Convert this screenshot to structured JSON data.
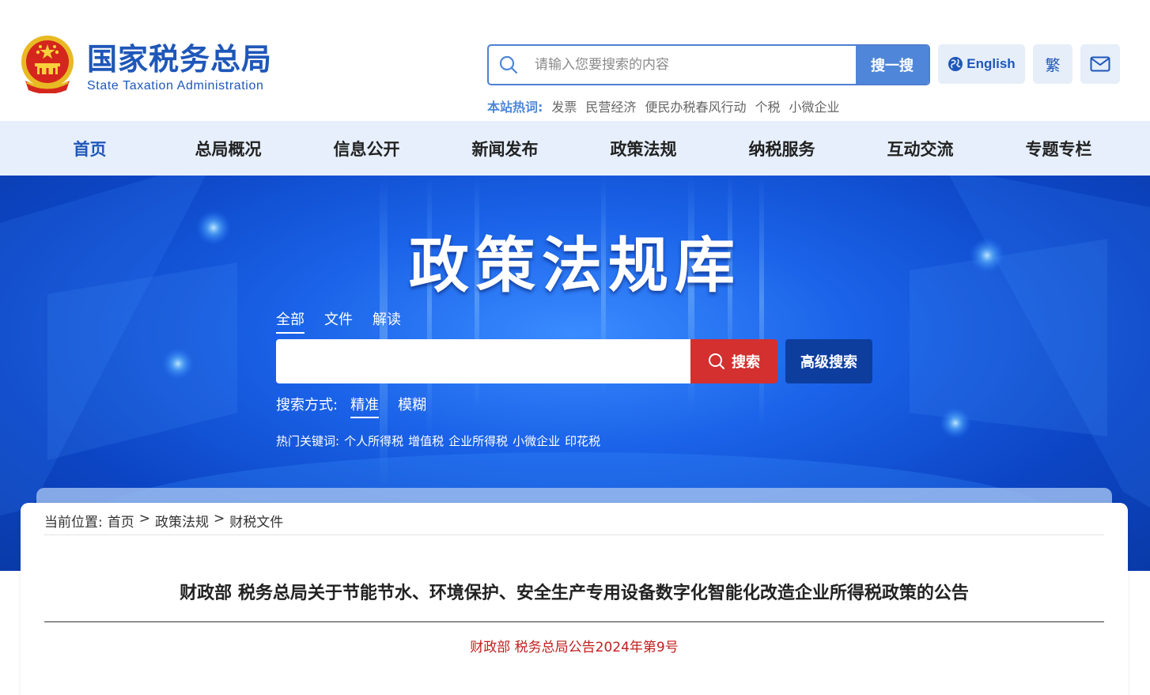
{
  "header": {
    "logo_cn": "国家税务总局",
    "logo_en": "State Taxation Administration",
    "search_placeholder": "请输入您要搜索的内容",
    "search_button": "搜一搜",
    "lang_label": "English",
    "traditional_label": "繁",
    "hot_label": "本站热词:",
    "hot_words": [
      "发票",
      "民营经济",
      "便民办税春风行动",
      "个税",
      "小微企业"
    ]
  },
  "nav": {
    "items": [
      "首页",
      "总局概况",
      "信息公开",
      "新闻发布",
      "政策法规",
      "纳税服务",
      "互动交流",
      "专题专栏"
    ],
    "active": "首页"
  },
  "banner": {
    "title": "政策法规库",
    "tabs": [
      "全部",
      "文件",
      "解读"
    ],
    "active_tab": "全部",
    "search_button": "搜索",
    "advanced_button": "高级搜索",
    "mode_label": "搜索方式:",
    "modes": [
      "精准",
      "模糊"
    ],
    "active_mode": "精准",
    "hot_label": "热门关键词:",
    "hot_keywords": [
      "个人所得税",
      "增值税",
      "企业所得税",
      "小微企业",
      "印花税"
    ]
  },
  "breadcrumb": {
    "label": "当前位置:",
    "items": [
      "首页",
      "政策法规",
      "财税文件"
    ],
    "separator": ">"
  },
  "document": {
    "title": "财政部 税务总局关于节能节水、环境保护、安全生产专用设备数字化智能化改造企业所得税政策的公告",
    "number": "财政部 税务总局公告2024年第9号"
  },
  "colors": {
    "brand_blue": "#1f57b9",
    "search_button": "#4f86d9",
    "nav_bg": "#e6effb",
    "banner_search_red": "#d3302f",
    "advanced_search": "#0d3e9e",
    "doc_number_red": "#c0201e"
  },
  "icons": {
    "emblem": "national-emblem-icon",
    "search": "search-icon",
    "globe": "globe-icon",
    "mail": "mail-icon"
  }
}
